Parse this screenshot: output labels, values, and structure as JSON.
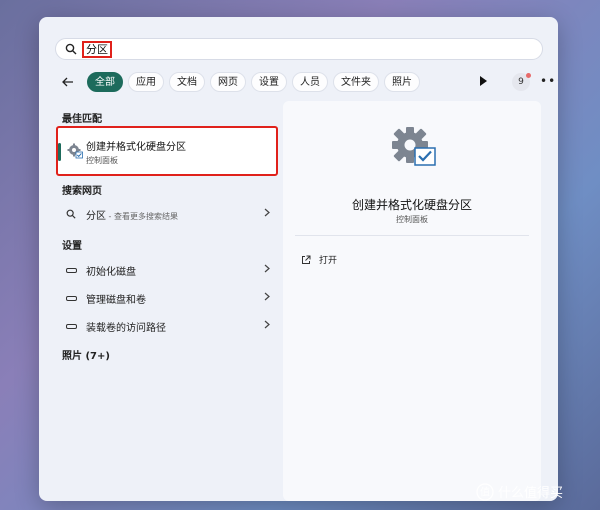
{
  "search": {
    "query": "分区"
  },
  "filters": {
    "tabs": [
      "全部",
      "应用",
      "文档",
      "网页",
      "设置",
      "人员",
      "文件夹",
      "照片"
    ],
    "active_index": 0,
    "avatar_badge": "9"
  },
  "best_match": {
    "heading": "最佳匹配",
    "title": "创建并格式化硬盘分区",
    "subtitle": "控制面板"
  },
  "web": {
    "heading": "搜索网页",
    "item": {
      "label": "分区",
      "hint": " - 查看更多搜索结果"
    }
  },
  "settings": {
    "heading": "设置",
    "items": [
      "初始化磁盘",
      "管理磁盘和卷",
      "装载卷的访问路径"
    ]
  },
  "photos": {
    "heading": "照片 (7+)"
  },
  "detail": {
    "title": "创建并格式化硬盘分区",
    "subtitle": "控制面板",
    "action": "打开"
  },
  "watermark": {
    "text": "什么值得买"
  },
  "colors": {
    "accent": "#1d6b5c",
    "highlight_border": "#e0211b"
  }
}
